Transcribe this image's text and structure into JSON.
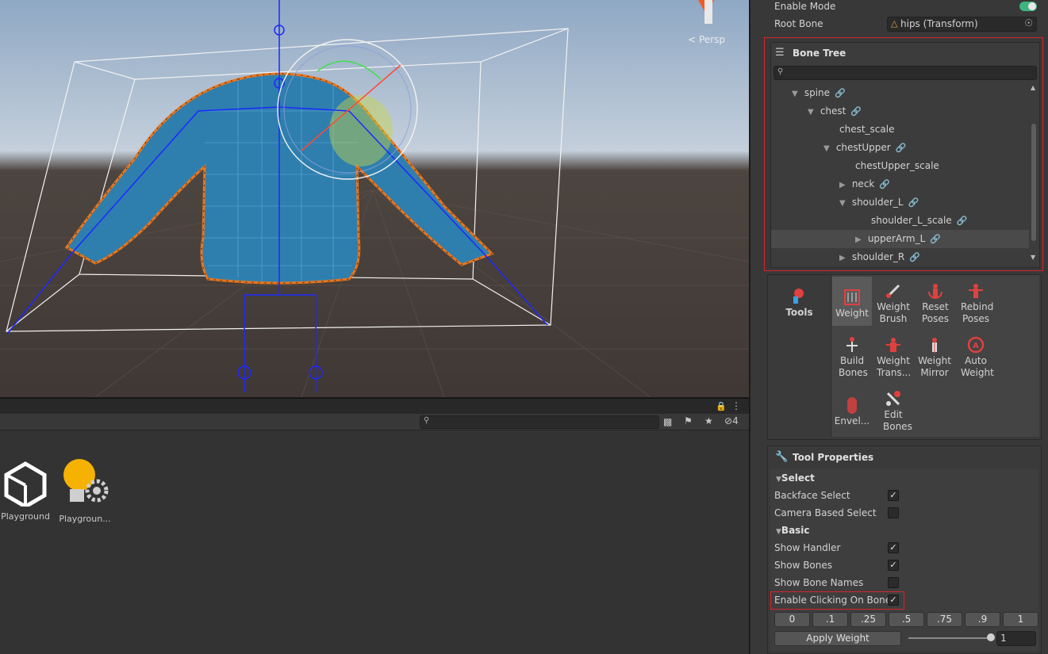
{
  "scene": {
    "view_label": "Persp"
  },
  "project": {
    "hidden_count": "4",
    "assets": [
      {
        "label": "Playground",
        "icon": "unity-logo-icon"
      },
      {
        "label": "Playgroun...",
        "icon": "lighting-settings-icon"
      }
    ]
  },
  "inspector": {
    "enable_mode_label": "Enable Mode",
    "enable_mode_on": true,
    "root_bone_label": "Root Bone",
    "root_bone_value": "hips (Transform)"
  },
  "bone_tree": {
    "title": "Bone Tree",
    "items": [
      {
        "label": "spine",
        "expanded": true,
        "link": true
      },
      {
        "label": "chest",
        "expanded": true,
        "link": true
      },
      {
        "label": "chest_scale",
        "link": false
      },
      {
        "label": "chestUpper",
        "expanded": true,
        "link": true
      },
      {
        "label": "chestUpper_scale",
        "link": false
      },
      {
        "label": "neck",
        "expanded": false,
        "link": true
      },
      {
        "label": "shoulder_L",
        "expanded": true,
        "link": true
      },
      {
        "label": "shoulder_L_scale",
        "link": true
      },
      {
        "label": "upperArm_L",
        "expanded": false,
        "link": true,
        "selected": true
      },
      {
        "label": "shoulder_R",
        "expanded": false,
        "link": true
      }
    ]
  },
  "tools": {
    "label": "Tools",
    "items": [
      {
        "label": "Weight",
        "selected": true
      },
      {
        "label": "Weight Brush"
      },
      {
        "label": "Reset Poses"
      },
      {
        "label": "Rebind Poses"
      },
      {
        "label": "Build Bones"
      },
      {
        "label": "Weight Trans..."
      },
      {
        "label": "Weight Mirror"
      },
      {
        "label": "Auto Weight"
      },
      {
        "label": "Envel..."
      },
      {
        "label": "Edit Bones"
      }
    ]
  },
  "tool_properties": {
    "title": "Tool Properties",
    "select_header": "Select",
    "basic_header": "Basic",
    "rows": [
      {
        "label": "Backface Select",
        "checked": true
      },
      {
        "label": "Camera Based Select",
        "checked": false
      },
      {
        "label": "Show Handler",
        "checked": true
      },
      {
        "label": "Show Bones",
        "checked": true
      },
      {
        "label": "Show Bone Names",
        "checked": false
      },
      {
        "label": "Enable Clicking On Bones",
        "checked": true
      }
    ],
    "weight_buttons": [
      "0",
      ".1",
      ".25",
      ".5",
      ".75",
      ".9",
      "1"
    ],
    "apply_label": "Apply Weight",
    "slider_value": 1,
    "weight_value": "1"
  },
  "colors": {
    "highlight": "#d9252a",
    "accent_red": "#e0413f",
    "toggle_on": "#3fb37f",
    "bone_blue": "#1c28ff",
    "mesh_outline": "#e8761e"
  }
}
